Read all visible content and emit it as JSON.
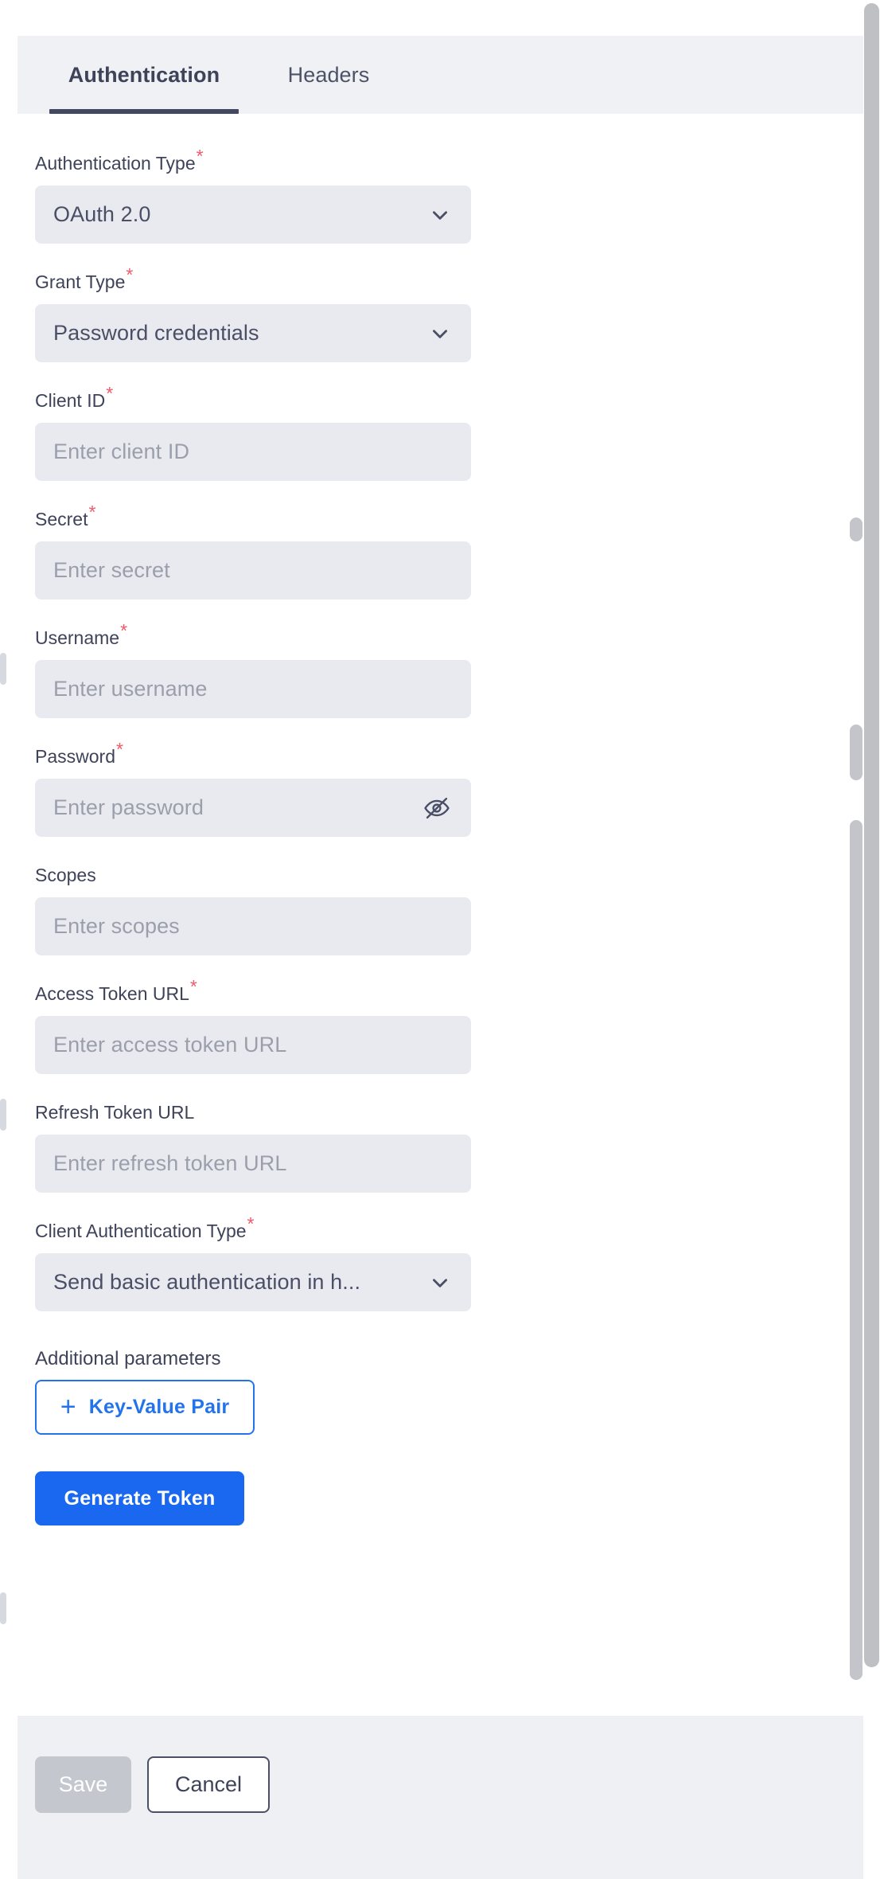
{
  "tabs": [
    {
      "label": "Authentication",
      "active": true
    },
    {
      "label": "Headers",
      "active": false
    }
  ],
  "form": {
    "fields": [
      {
        "id": "authentication-type",
        "label": "Authentication Type",
        "required": true,
        "type": "select",
        "value": "OAuth 2.0"
      },
      {
        "id": "grant-type",
        "label": "Grant Type",
        "required": true,
        "type": "select",
        "value": "Password credentials"
      },
      {
        "id": "client-id",
        "label": "Client ID",
        "required": true,
        "type": "text",
        "placeholder": "Enter client ID",
        "value": ""
      },
      {
        "id": "secret",
        "label": "Secret",
        "required": true,
        "type": "text",
        "placeholder": "Enter secret",
        "value": ""
      },
      {
        "id": "username",
        "label": "Username",
        "required": true,
        "type": "text",
        "placeholder": "Enter username",
        "value": ""
      },
      {
        "id": "password",
        "label": "Password",
        "required": true,
        "type": "password",
        "placeholder": "Enter password",
        "value": ""
      },
      {
        "id": "scopes",
        "label": "Scopes",
        "required": false,
        "type": "text",
        "placeholder": "Enter scopes",
        "value": ""
      },
      {
        "id": "access-token-url",
        "label": "Access Token URL",
        "required": true,
        "type": "text",
        "placeholder": "Enter access token URL",
        "value": ""
      },
      {
        "id": "refresh-token-url",
        "label": "Refresh Token URL",
        "required": false,
        "type": "text",
        "placeholder": "Enter refresh token URL",
        "value": ""
      },
      {
        "id": "client-authentication-type",
        "label": "Client Authentication Type",
        "required": true,
        "type": "select",
        "value": "Send basic authentication in h..."
      }
    ],
    "additional_parameters": {
      "label": "Additional parameters",
      "add_button_label": "Key-Value Pair",
      "add_button_icon": "plus-icon"
    },
    "generate_token_label": "Generate Token"
  },
  "footer": {
    "save_label": "Save",
    "save_disabled": true,
    "cancel_label": "Cancel"
  },
  "icons": {
    "chevron": "chevron-down-icon",
    "password_toggle": "eye-off-icon"
  },
  "colors": {
    "accent_blue": "#1a68f0",
    "link_blue": "#2374ec",
    "required_red": "#f2596a",
    "text_navy": "#3e4359",
    "field_bg": "#e9eaf0",
    "tabbar_bg": "#f0f1f5",
    "footer_bg": "#eff0f4",
    "save_disabled_bg": "#c5c7cf"
  }
}
